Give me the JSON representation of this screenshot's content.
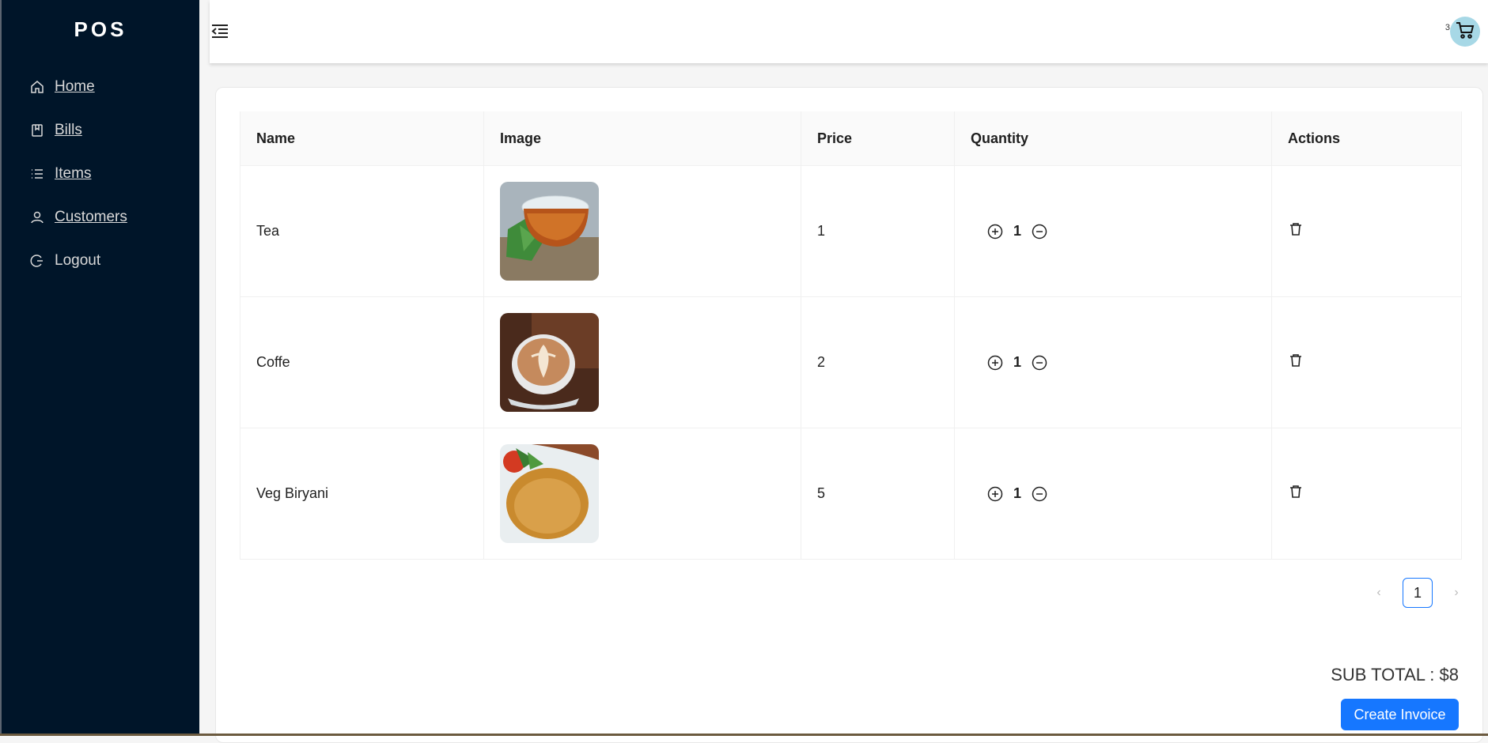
{
  "app": {
    "logo": "POS"
  },
  "sidebar": {
    "items": [
      {
        "label": "Home",
        "icon": "home-icon"
      },
      {
        "label": "Bills",
        "icon": "book-icon"
      },
      {
        "label": "Items",
        "icon": "list-icon"
      },
      {
        "label": "Customers",
        "icon": "user-icon"
      },
      {
        "label": "Logout",
        "icon": "logout-icon"
      }
    ]
  },
  "header": {
    "cart_count": "3",
    "cart_icon": "cart-icon",
    "menu_icon": "menu-fold-icon"
  },
  "table": {
    "columns": [
      "Name",
      "Image",
      "Price",
      "Quantity",
      "Actions"
    ],
    "rows": [
      {
        "name": "Tea",
        "image": "tea-image",
        "price": "1",
        "quantity": "1"
      },
      {
        "name": "Coffe",
        "image": "coffee-image",
        "price": "2",
        "quantity": "1"
      },
      {
        "name": "Veg Biryani",
        "image": "biryani-image",
        "price": "5",
        "quantity": "1"
      }
    ]
  },
  "pagination": {
    "current": "1"
  },
  "summary": {
    "subtotal": "SUB TOTAL : $8"
  },
  "actions": {
    "create_invoice": "Create Invoice"
  },
  "colors": {
    "sidebar": "#001529",
    "primary": "#1677ff",
    "cart_bg": "#a7d8e6"
  }
}
